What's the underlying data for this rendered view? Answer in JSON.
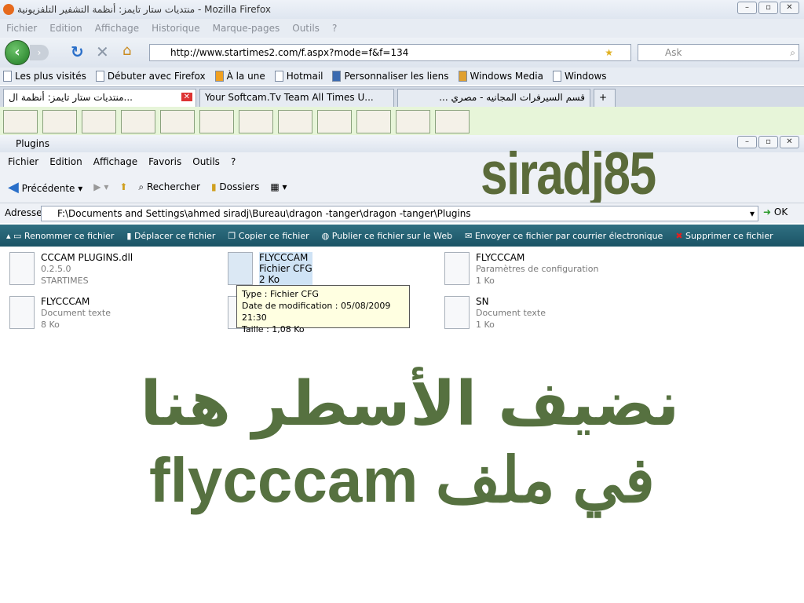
{
  "firefox": {
    "title": "منتديات ستار تايمز: أنظمة التشفير التلفزيونية - Mozilla Firefox",
    "menu": [
      "Fichier",
      "Edition",
      "Affichage",
      "Historique",
      "Marque-pages",
      "Outils",
      "?"
    ],
    "url": "http://www.startimes2.com/f.aspx?mode=f&f=134",
    "search_placeholder": "Ask",
    "bookmarks": [
      "Les plus visités",
      "Débuter avec Firefox",
      "À la une",
      "Hotmail",
      "Personnaliser les liens",
      "Windows Media",
      "Windows"
    ],
    "tabs": [
      "منتديات ستار تايمز: أنظمة ال...",
      "Your Softcam.Tv Team All Times U...",
      "قسم السيرفرات المجانيه - مصري ..."
    ]
  },
  "explorer": {
    "title": "Plugins",
    "menu": [
      "Fichier",
      "Edition",
      "Affichage",
      "Favoris",
      "Outils",
      "?"
    ],
    "toolbar": {
      "back": "Précédente",
      "search": "Rechercher",
      "folders": "Dossiers"
    },
    "address_label": "Adresse",
    "address": "F:\\Documents and Settings\\ahmed siradj\\Bureau\\dragon -tanger\\dragon -tanger\\Plugins",
    "go": "OK",
    "tasks": [
      "Renommer ce fichier",
      "Déplacer ce fichier",
      "Copier ce fichier",
      "Publier ce fichier sur le Web",
      "Envoyer ce fichier par courrier électronique",
      "Supprimer ce fichier"
    ],
    "files": [
      {
        "name": "CCCAM PLUGINS.dll",
        "line2": "0.2.5.0",
        "line3": "STARTIMES"
      },
      {
        "name": "FLYCCCAM",
        "line2": "Fichier CFG",
        "line3": "2 Ko"
      },
      {
        "name": "FLYCCCAM",
        "line2": "Paramètres de configuration",
        "line3": "1 Ko"
      },
      {
        "name": "FLYCCCAM",
        "line2": "Document texte",
        "line3": "8 Ko"
      },
      {
        "name": "",
        "line2": "",
        "line3": "1 Ko"
      },
      {
        "name": "SN",
        "line2": "Document texte",
        "line3": "1 Ko"
      }
    ],
    "tooltip": [
      "Type : Fichier CFG",
      "Date de modification : 05/08/2009 21:30",
      "Taille  : 1,08 Ko"
    ]
  },
  "overlay": {
    "brand": "siradj85",
    "line1": "نضيف الأسطر هنا",
    "line2": "في ملف flycccam"
  }
}
